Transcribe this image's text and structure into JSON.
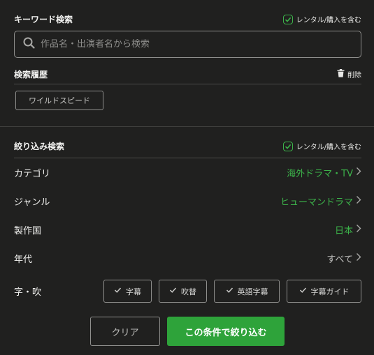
{
  "keyword": {
    "title": "キーワード検索",
    "include_rental_label": "レンタル/購入を含む",
    "include_rental_checked": true,
    "placeholder": "作品名・出演者名から検索",
    "value": ""
  },
  "history": {
    "title": "検索履歴",
    "delete_label": "削除",
    "items": [
      "ワイルドスピード"
    ]
  },
  "filter": {
    "title": "絞り込み検索",
    "include_rental_label": "レンタル/購入を含む",
    "include_rental_checked": true,
    "rows": [
      {
        "label": "カテゴリ",
        "value": "海外ドラマ・TV"
      },
      {
        "label": "ジャンル",
        "value": "ヒューマンドラマ"
      },
      {
        "label": "製作国",
        "value": "日本"
      },
      {
        "label": "年代",
        "value": "すべて"
      }
    ],
    "subtitle": {
      "label": "字・吹",
      "options": [
        "字幕",
        "吹替",
        "英語字幕",
        "字幕ガイド"
      ]
    }
  },
  "actions": {
    "clear_label": "クリア",
    "apply_label": "この条件で絞り込む"
  },
  "colors": {
    "background": "#20201f",
    "accent": "#3cb34a",
    "apply_button": "#2ea33a",
    "border": "#8f8f8d"
  },
  "icons": [
    "check-icon",
    "search-icon",
    "trash-icon",
    "chevron-right-icon"
  ]
}
